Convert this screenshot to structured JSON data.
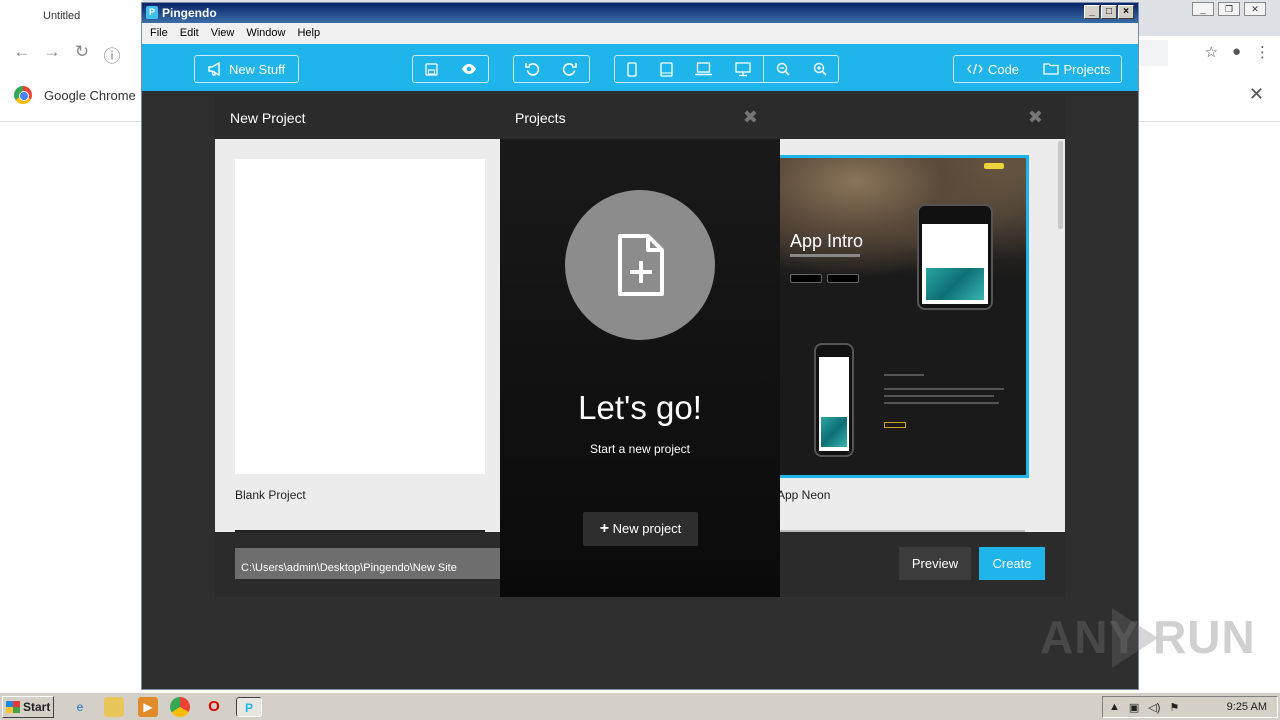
{
  "chrome": {
    "tab_title": "Untitled",
    "infobar_text": "Google Chrome"
  },
  "app": {
    "title": "Pingendo",
    "menu": [
      "File",
      "Edit",
      "View",
      "Window",
      "Help"
    ],
    "toolbar": {
      "new_stuff": "New Stuff",
      "code": "Code",
      "projects": "Projects"
    }
  },
  "new_project_dialog": {
    "title": "New Project",
    "templates": [
      {
        "label": "Blank Project"
      },
      {
        "label": "App Neon"
      }
    ],
    "neon_preview": {
      "heading": "App Intro"
    },
    "path_value": "C:\\Users\\admin\\Desktop\\Pingendo\\New Site",
    "preview_label": "Preview",
    "create_label": "Create"
  },
  "projects_panel": {
    "title": "Projects",
    "heading": "Let's go!",
    "subheading": "Start a new project",
    "button_label": "New project"
  },
  "watermark": "ANY RUN",
  "taskbar": {
    "start_label": "Start",
    "clock": "9:25 AM"
  },
  "colors": {
    "accent": "#1fb5ea",
    "panel_dark": "#2b2b2b"
  }
}
